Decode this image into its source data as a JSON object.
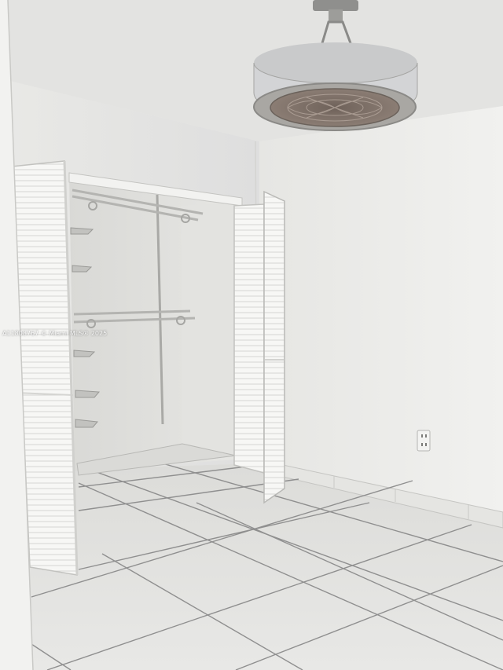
{
  "photo": {
    "watermark": "A11808767 © Miami MLS® 2025",
    "subjects": [
      "textured-ceiling",
      "ceiling-fan-light",
      "reach-in-closet",
      "louvered-bifold-doors",
      "wire-shelving",
      "electrical-outlet",
      "ceramic-tile-floor",
      "white-walls"
    ]
  },
  "colors": {
    "wall": "#ececea",
    "wall_shadow": "#dfdfdc",
    "ceiling": "#e4e4e2",
    "floor_tile": "#e2e2e0",
    "grout": "#8c8c8c",
    "fan_metal": "#9a9a98",
    "fan_shade": "#d2d3d4",
    "door": "#f6f6f4"
  }
}
